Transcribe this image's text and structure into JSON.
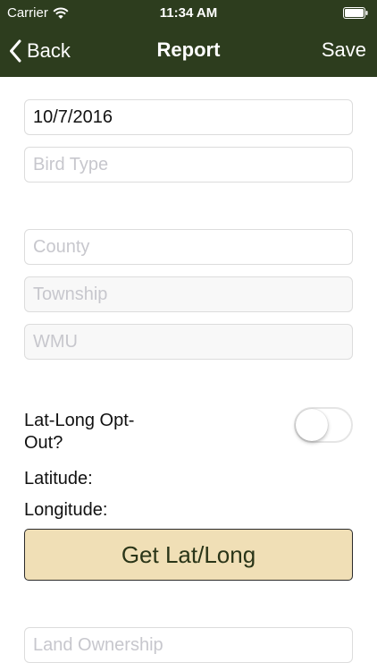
{
  "status_bar": {
    "carrier": "Carrier",
    "time": "11:34 AM"
  },
  "nav": {
    "back_label": "Back",
    "title": "Report",
    "save_label": "Save"
  },
  "form": {
    "date": {
      "value": "10/7/2016"
    },
    "bird_type": {
      "placeholder": "Bird Type"
    },
    "county": {
      "placeholder": "County"
    },
    "township": {
      "placeholder": "Township"
    },
    "wmu": {
      "placeholder": "WMU"
    },
    "opt_out": {
      "label": "Lat-Long Opt-Out?",
      "on": false
    },
    "latitude_label": "Latitude:",
    "longitude_label": "Longitude:",
    "get_latlong_label": "Get Lat/Long",
    "land_ownership": {
      "placeholder": "Land Ownership"
    }
  },
  "colors": {
    "nav_background": "#2d3d1e",
    "button_background": "#f0dfb6",
    "button_text": "#2a3518"
  }
}
